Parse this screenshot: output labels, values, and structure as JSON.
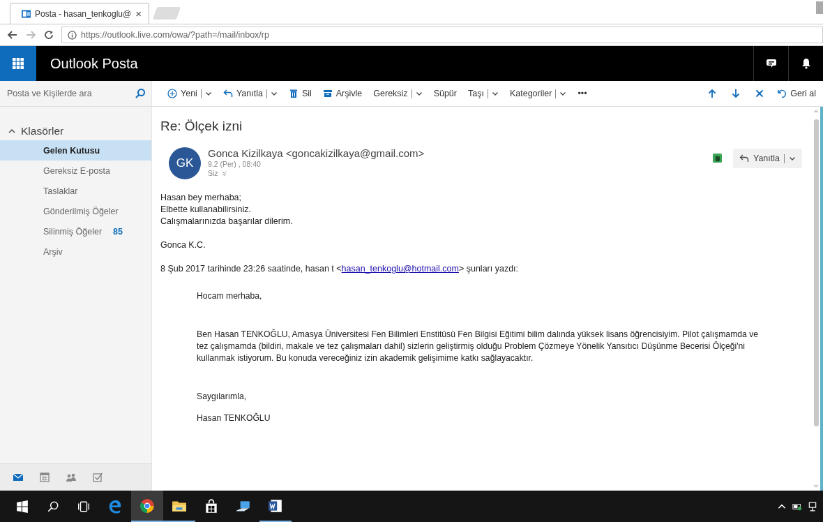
{
  "browser": {
    "tab": {
      "title": "Posta - hasan_tenkoglu@",
      "close": "×"
    },
    "url": "https://outlook.live.com/owa/?path=/mail/inbox/rp"
  },
  "app": {
    "title": "Outlook Posta"
  },
  "search": {
    "placeholder": "Posta ve Kişilerde ara"
  },
  "toolbar": [
    {
      "kind": "plus",
      "label": "Yeni",
      "dropdown": true
    },
    {
      "kind": "reply",
      "label": "Yanıtla",
      "dropdown": true
    },
    {
      "kind": "trash",
      "label": "Sil",
      "dropdown": false
    },
    {
      "kind": "archive",
      "label": "Arşivle",
      "dropdown": false
    },
    {
      "kind": "none",
      "label": "Gereksiz",
      "dropdown": true
    },
    {
      "kind": "none",
      "label": "Süpür",
      "dropdown": false
    },
    {
      "kind": "none",
      "label": "Taşı",
      "dropdown": true
    },
    {
      "kind": "none",
      "label": "Kategoriler",
      "dropdown": true
    },
    {
      "kind": "none",
      "label": "•••",
      "dropdown": false
    }
  ],
  "toolbar_right": [
    {
      "kind": "up"
    },
    {
      "kind": "down"
    },
    {
      "kind": "close"
    },
    {
      "kind": "undo",
      "label": "Geri al"
    }
  ],
  "folders": {
    "label": "Klasörler",
    "expanded": true,
    "children": [
      {
        "label": "Gelen Kutusu",
        "selected": true
      },
      {
        "label": "Gereksiz E-posta",
        "selected": false
      },
      {
        "label": "Taslaklar",
        "selected": false
      },
      {
        "label": "Gönderilmiş Öğeler",
        "selected": false
      },
      {
        "label": "Silinmiş Öğeler",
        "selected": false,
        "count": "85"
      },
      {
        "label": "Arşiv",
        "selected": false
      }
    ]
  },
  "bottom_nav": [
    {
      "kind": "mail",
      "selected": true
    },
    {
      "kind": "calendar",
      "selected": false
    },
    {
      "kind": "people",
      "selected": false
    },
    {
      "kind": "tasks",
      "selected": false
    }
  ],
  "message": {
    "subject": "Re: Ölçek izni",
    "initials": "GK",
    "sender": "Gonca Kizilkaya <goncakizilkaya@gmail.com>",
    "date": "9.2 (Per) , 08:40",
    "to": "Siz",
    "reply": "Yanıtla",
    "body": [
      "Hasan bey merhaba;",
      "Elbette kullanabilirsiniz.",
      "Calışmalarınızda başarılar dilerim."
    ],
    "signature": "Gonca K.C.",
    "quote_header": {
      "before": "8 Şub 2017 tarihinde 23:26 saatinde, hasan t <",
      "link": "hasan_tenkoglu@hotmail.com",
      "after": "> şunları yazdı:"
    },
    "quoted": [
      {
        "kind": "line",
        "text": "Hocam merhaba,"
      },
      {
        "kind": "para",
        "text": "Ben Hasan TENKOĞLU, Amasya Üniversitesi Fen Bilimleri Enstitüsü Fen Bilgisi Eğitimi bilim dalında yüksek lisans öğrencisiyim. Pilot çalışmamda ve tez çalışmamda (bildiri, makale ve tez çalışmaları dahil) sizlerin geliştirmiş olduğu Problem Çözmeye Yönelik Yansıtıcı Düşünme Becerisi Ölçeği'ni kullanmak istiyorum. Bu konuda vereceğiniz izin akademik gelişimime katkı sağlayacaktır."
      },
      {
        "kind": "line",
        "text": "Saygılarımla,"
      },
      {
        "kind": "last",
        "text": "Hasan TENKOĞLU"
      }
    ]
  },
  "taskbar": [
    {
      "kind": "edge",
      "running": false
    },
    {
      "kind": "chrome",
      "running": true,
      "active": true
    },
    {
      "kind": "folder",
      "running": true,
      "active": false
    },
    {
      "kind": "store",
      "running": false
    },
    {
      "kind": "pc",
      "running": false
    },
    {
      "kind": "word",
      "running": true,
      "active": false
    }
  ]
}
